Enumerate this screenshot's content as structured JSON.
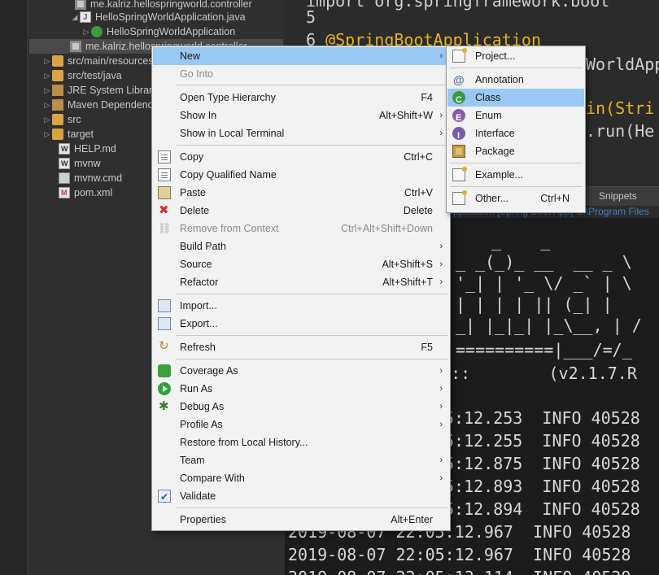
{
  "explorer": {
    "rows": [
      {
        "label": "me.kalriz.hellospringworld.controller"
      },
      {
        "label": "HelloSpringWorldApplication.java"
      },
      {
        "label": "HelloSpringWorldApplication"
      },
      {
        "label": "me.kalriz.hellospringworld.controller"
      },
      {
        "label": "src/main/resources"
      },
      {
        "label": "src/test/java"
      },
      {
        "label": "JRE System Library"
      },
      {
        "label": "Maven Dependencies"
      },
      {
        "label": "src"
      },
      {
        "label": "target"
      },
      {
        "label": "HELP.md"
      },
      {
        "label": "mvnw"
      },
      {
        "label": "mvnw.cmd"
      },
      {
        "label": "pom.xml"
      }
    ]
  },
  "editor": {
    "line5_num": "5",
    "line6_num": "6",
    "line6_annotation": "@SpringBootApplication",
    "frag_top": "import org.springframework.boot",
    "frag_worldapp": "WorldApp",
    "frag_main": "ain(Stri",
    "frag_run": "n.run(He"
  },
  "console": {
    "tab_label": "Snippets",
    "header": "Application [Spring Boot App] C:\\Program Files",
    "ascii": [
      "  _    _",
      "_ _(_)_ __  __ _ \\",
      "'_| | '_ \\/ _` | \\",
      "| | | | || (_| |",
      "_| |_|_| |_\\__, | /",
      "==========|___/=/_"
    ],
    "version": "  ::        (v2.1.7.R",
    "log_lines": [
      "5:12.253  INFO 40528",
      "5:12.255  INFO 40528",
      "5:12.875  INFO 40528",
      "5:12.893  INFO 40528",
      "5:12.894  INFO 40528",
      "2019-08-07 22:05:12.967  INFO 40528",
      "2019-08-07 22:05:12.967  INFO 40528",
      "2019-08-07 22:05:13.114  INFO 40528"
    ]
  },
  "context_menu": {
    "new": "New",
    "go_into": "Go Into",
    "open_type_hierarchy": "Open Type Hierarchy",
    "open_type_hierarchy_sc": "F4",
    "show_in": "Show In",
    "show_in_sc": "Alt+Shift+W",
    "show_in_terminal": "Show in Local Terminal",
    "copy": "Copy",
    "copy_sc": "Ctrl+C",
    "copy_qualified": "Copy Qualified Name",
    "paste": "Paste",
    "paste_sc": "Ctrl+V",
    "delete": "Delete",
    "delete_sc": "Delete",
    "remove_context": "Remove from Context",
    "remove_context_sc": "Ctrl+Alt+Shift+Down",
    "build_path": "Build Path",
    "source": "Source",
    "source_sc": "Alt+Shift+S",
    "refactor": "Refactor",
    "refactor_sc": "Alt+Shift+T",
    "import": "Import...",
    "export": "Export...",
    "refresh": "Refresh",
    "refresh_sc": "F5",
    "coverage_as": "Coverage As",
    "run_as": "Run As",
    "debug_as": "Debug As",
    "profile_as": "Profile As",
    "restore_history": "Restore from Local History...",
    "team": "Team",
    "compare_with": "Compare With",
    "validate": "Validate",
    "properties": "Properties",
    "properties_sc": "Alt+Enter"
  },
  "submenu": {
    "project": "Project...",
    "annotation": "Annotation",
    "class": "Class",
    "enum": "Enum",
    "interface": "Interface",
    "package": "Package",
    "example": "Example...",
    "other": "Other...",
    "other_sc": "Ctrl+N"
  },
  "colors": {
    "highlight": "#99c8f4",
    "menu_bg": "#f2f2f2",
    "annotation": "#e6b422"
  }
}
